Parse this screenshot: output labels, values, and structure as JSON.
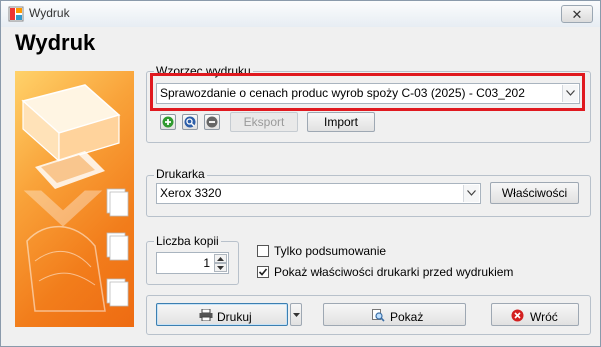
{
  "window": {
    "title": "Wydruk"
  },
  "heading": "Wydruk",
  "template_group": {
    "label": "Wzorzec wydruku",
    "selected": "Sprawozdanie o cenach produc wyrob spoży C-03 (2025) - C03_202",
    "buttons": {
      "export": "Eksport",
      "import": "Import"
    },
    "icons": [
      "add-icon",
      "edit-icon",
      "remove-icon"
    ]
  },
  "printer_group": {
    "label": "Drukarka",
    "selected": "Xerox 3320",
    "properties_button": "Właściwości"
  },
  "copies_group": {
    "label": "Liczba kopii",
    "value": "1"
  },
  "options": {
    "summary_only": {
      "label": "Tylko podsumowanie",
      "checked": false
    },
    "show_printer_props": {
      "label": "Pokaż właściwości drukarki przed wydrukiem",
      "checked": true
    }
  },
  "footer": {
    "print": "Drukuj",
    "preview": "Pokaż",
    "back": "Wróć"
  },
  "colors": {
    "highlight": "#e0191f",
    "accent": "#f27d1b"
  }
}
